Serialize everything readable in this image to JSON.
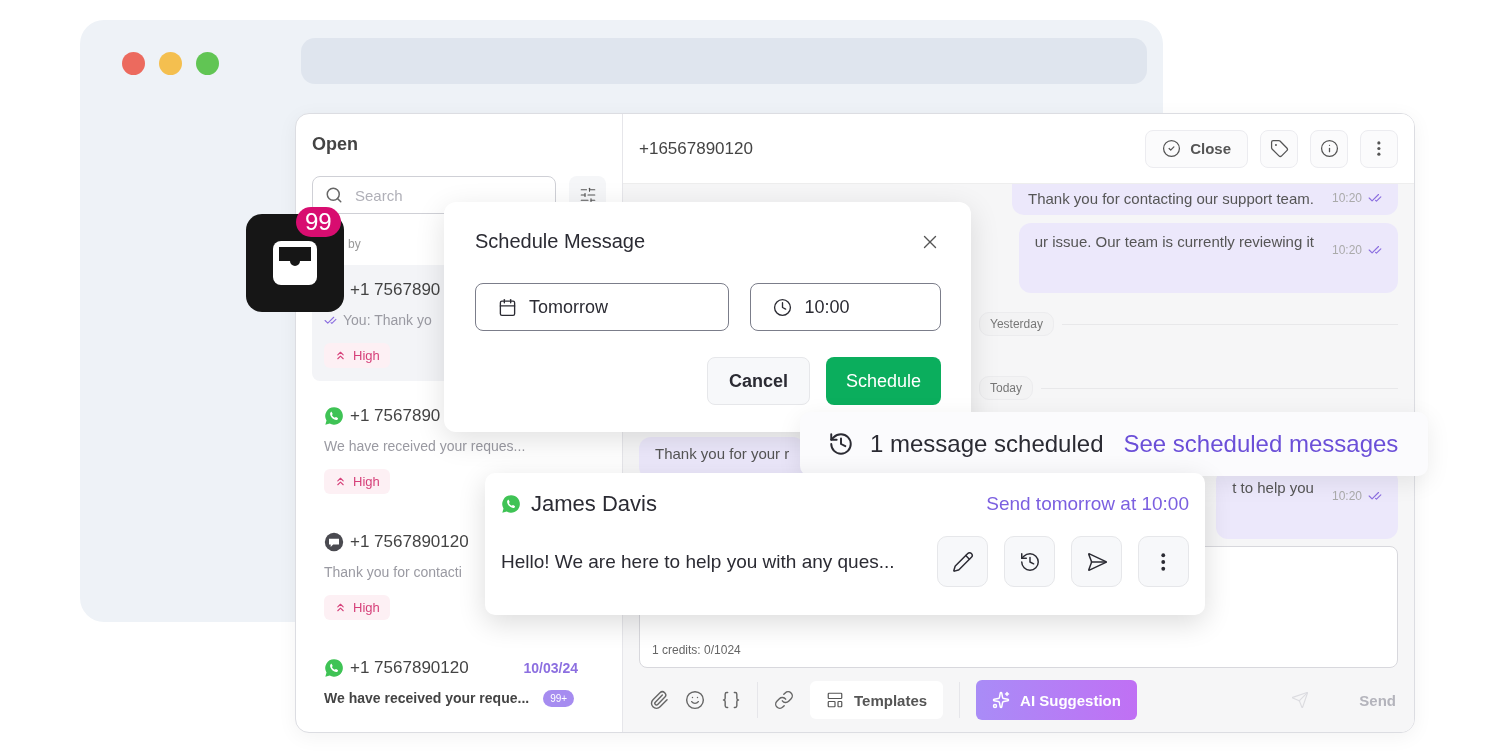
{
  "browser": {
    "traffic_lights": [
      {
        "color": "#ec6a5e"
      },
      {
        "color": "#f4bf4f"
      },
      {
        "color": "#61c554"
      }
    ]
  },
  "inbox_badge": {
    "count": "99"
  },
  "sidebar": {
    "title": "Open",
    "search": {
      "placeholder": "Search"
    },
    "sort_label": "by",
    "conversations": [
      {
        "phone": "+1 7567890",
        "preview": "You: Thank yo",
        "sent": true,
        "priority": "High",
        "selected": true,
        "unread": false
      },
      {
        "kind": "whatsapp",
        "phone": "+1 7567890",
        "preview": "We have received your reques...",
        "sent": false,
        "priority": "High",
        "selected": false,
        "unread": false
      },
      {
        "kind": "sms",
        "phone": "+1 7567890120",
        "preview": "Thank you for contacti",
        "sent": false,
        "priority": "High",
        "selected": false,
        "unread": false
      },
      {
        "kind": "whatsapp",
        "phone": "+1 7567890120",
        "date": "10/03/24",
        "preview": "We have received your reque...",
        "count": "99+",
        "sent": false,
        "selected": false,
        "unread": true
      }
    ]
  },
  "chat": {
    "contact": "+16567890120",
    "actions": [
      {
        "kind": "close",
        "label": "Close"
      },
      {
        "kind": "tag"
      },
      {
        "kind": "info"
      },
      {
        "kind": "more"
      }
    ],
    "messages": [
      {
        "kind": "out",
        "text": "Thank you for contacting our support team.",
        "time": "10:20",
        "cut_top": true
      },
      {
        "kind": "out",
        "text": "ur issue. Our team is currently reviewing it",
        "time": "10:20",
        "cut_top": false
      },
      {
        "kind": "divider",
        "text": "Yesterday"
      },
      {
        "kind": "divider",
        "text": "Today"
      },
      {
        "kind": "in",
        "text": "Thank you for your r"
      },
      {
        "kind": "out",
        "text": "t to help you",
        "time": "10:20",
        "cut_top": false
      }
    ],
    "compose": {
      "credits": "1 credits: 0/1024"
    },
    "toolbar": [
      {
        "kind": "attach"
      },
      {
        "kind": "emoji"
      },
      {
        "kind": "variables"
      },
      {
        "kind": "separator"
      },
      {
        "kind": "link"
      },
      {
        "kind": "templates",
        "label": "Templates"
      },
      {
        "kind": "separator"
      },
      {
        "kind": "ai",
        "label": "AI Suggestion"
      }
    ],
    "send_button": {
      "label": "Send",
      "disabled": true
    }
  },
  "schedule_dialog": {
    "title": "Schedule Message",
    "date": "Tomorrow",
    "time": "10:00",
    "buttons": [
      {
        "kind": "secondary",
        "label": "Cancel"
      },
      {
        "kind": "primary",
        "label": "Schedule"
      }
    ]
  },
  "scheduled_toast": {
    "text": "1 message scheduled",
    "link": "See scheduled messages"
  },
  "scheduled_card": {
    "name": "James Davis",
    "when": "Send tomorrow at 10:00",
    "message": "Hello! We are here to help you with any ques...",
    "actions": [
      {
        "kind": "edit"
      },
      {
        "kind": "reschedule"
      },
      {
        "kind": "send"
      },
      {
        "kind": "more"
      }
    ]
  }
}
